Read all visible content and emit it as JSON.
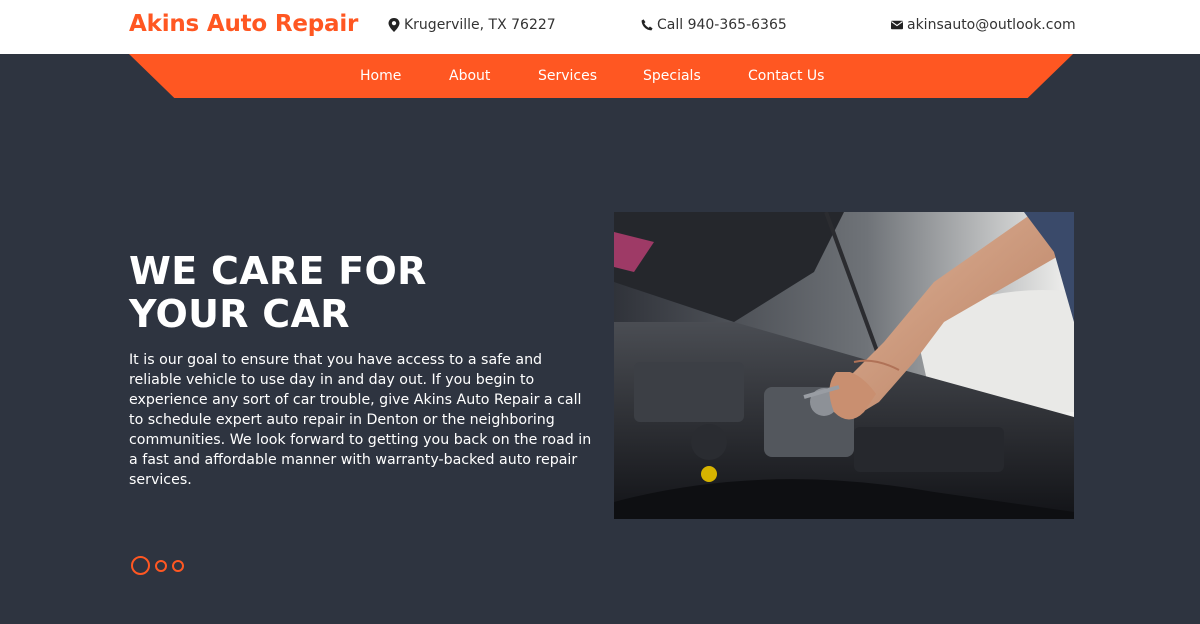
{
  "header": {
    "brand": "Akins Auto Repair",
    "location": "Krugerville, TX 76227",
    "phone": "Call 940-365-6365",
    "email": "akinsauto@outlook.com"
  },
  "nav": {
    "items": [
      {
        "label": "Home"
      },
      {
        "label": "About"
      },
      {
        "label": "Services"
      },
      {
        "label": "Specials"
      },
      {
        "label": "Contact Us"
      }
    ]
  },
  "hero": {
    "title_line1": "WE CARE FOR",
    "title_line2": "YOUR CAR",
    "text": "It is our goal to ensure that you have access to a safe and reliable vehicle to use day in and day out. If you begin to experience any sort of car trouble, give Akins Auto Repair a call to schedule expert auto repair in Denton or the neighboring communities. We look forward to getting you back on the road in a fast and affordable manner with warranty-backed auto repair services."
  },
  "carousel": {
    "slide_count": 3,
    "active_index": 0
  },
  "colors": {
    "accent": "#ff5722",
    "background": "#2e3440",
    "header_bg": "#ffffff"
  }
}
